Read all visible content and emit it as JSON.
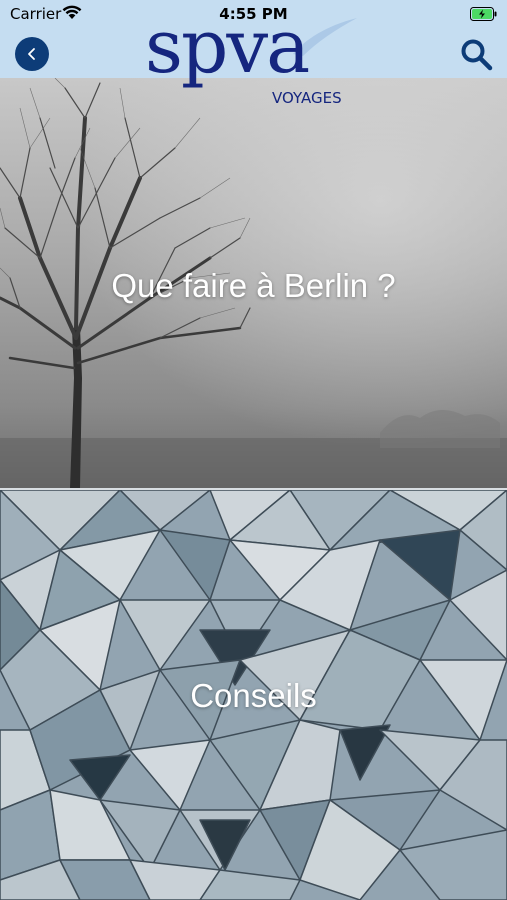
{
  "status_bar": {
    "carrier": "Carrier",
    "time": "4:55 PM"
  },
  "header": {
    "logo_word": "spva",
    "logo_sub": "VOYAGES",
    "back_icon": "chevron-left-icon",
    "search_icon": "search-icon",
    "background": "#c5ddf1",
    "accent": "#0d3c78"
  },
  "tiles": [
    {
      "label": "Que faire à Berlin ?"
    },
    {
      "label": "Conseils"
    }
  ]
}
